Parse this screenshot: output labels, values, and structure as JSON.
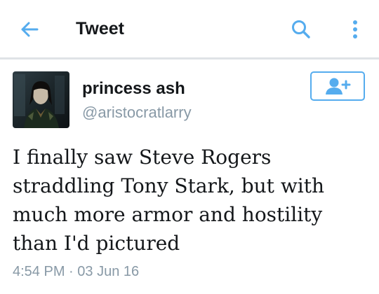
{
  "header": {
    "title": "Tweet"
  },
  "tweet": {
    "author": {
      "display_name": "princess ash",
      "handle": "@aristocratlarry"
    },
    "text": "I finally saw Steve Rogers straddling Tony Stark, but with much more armor and hostility than I'd pictured",
    "time": "4:54 PM",
    "separator": "·",
    "date": "03 Jun 16"
  },
  "icons": {
    "back": "arrow-left-icon",
    "search": "search-icon",
    "overflow": "more-vertical-icon",
    "follow": "add-user-icon"
  },
  "colors": {
    "accent": "#55acee",
    "text_primary": "#14171a",
    "text_secondary": "#8899a6",
    "divider": "#dfe3e6"
  }
}
